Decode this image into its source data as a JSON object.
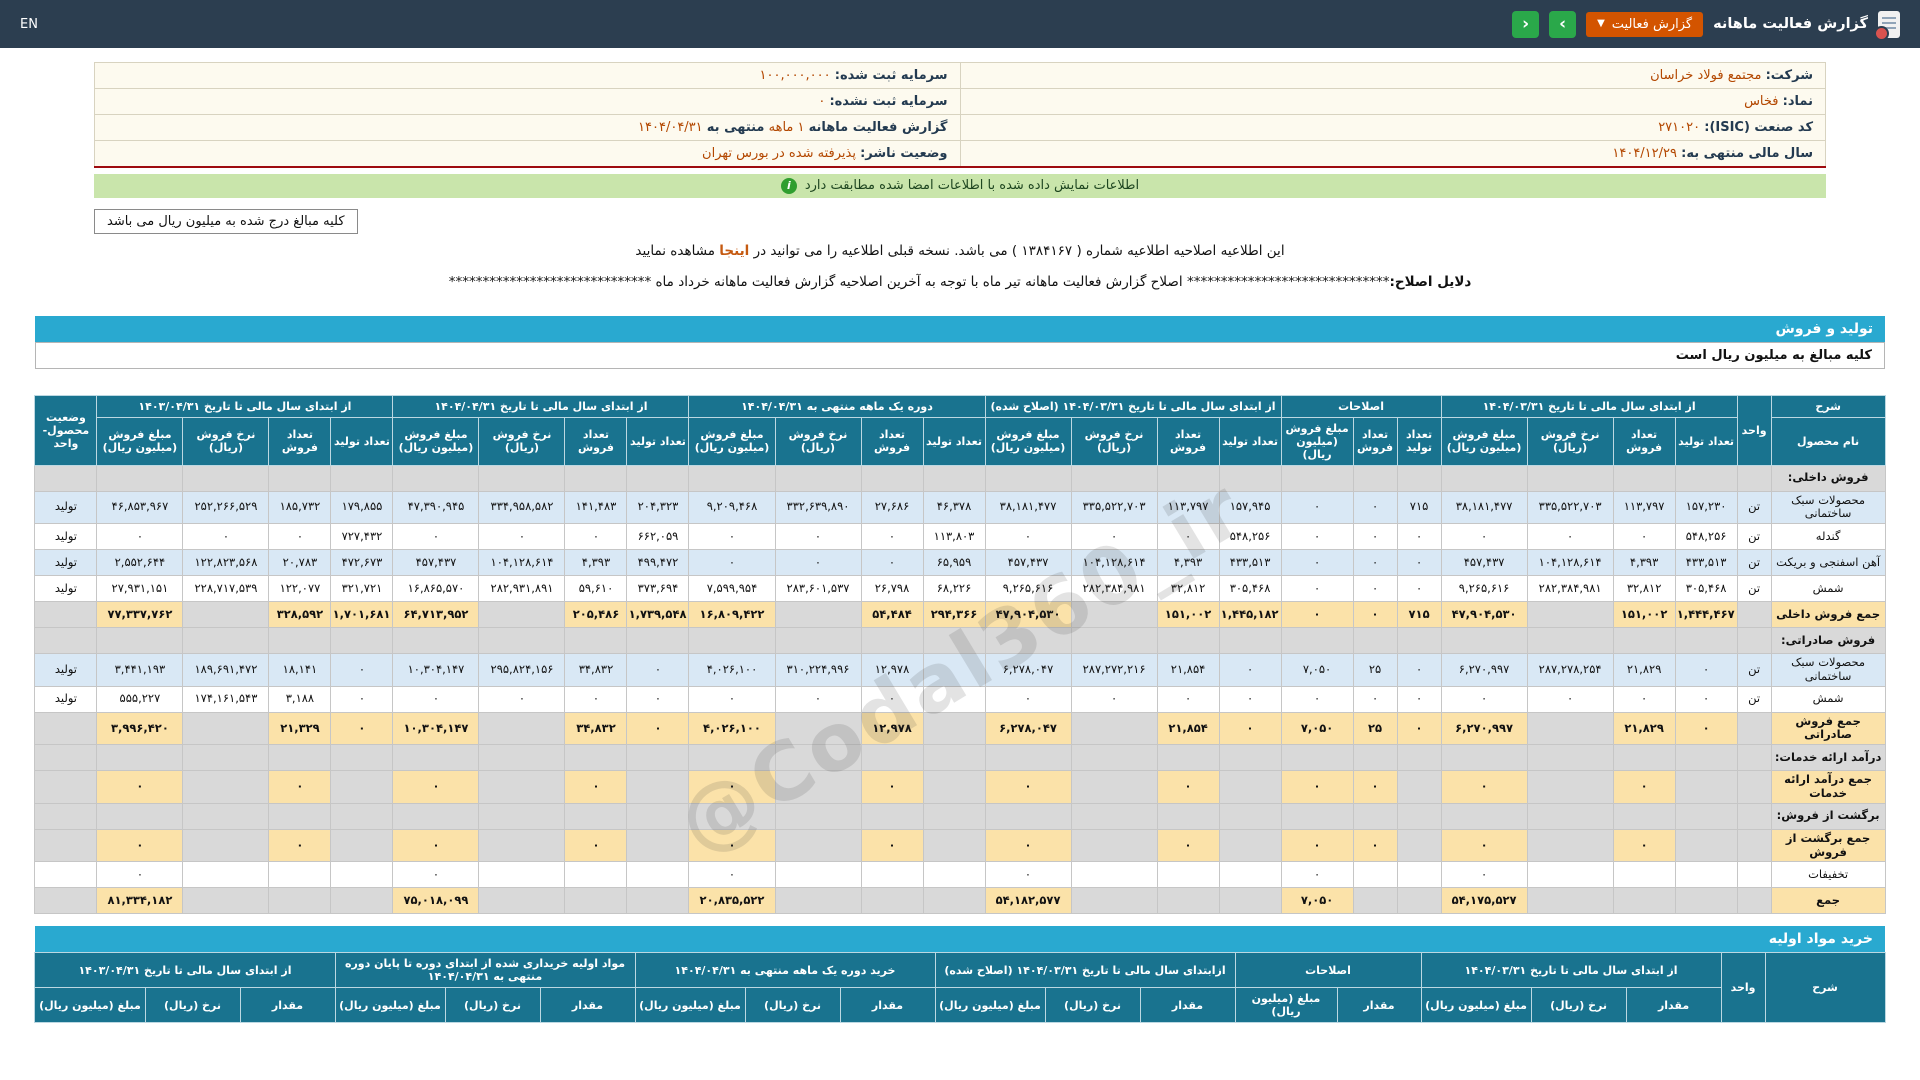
{
  "topbar": {
    "en": "EN",
    "title": "گزارش فعالیت ماهانه",
    "report_btn": "گزارش فعالیت",
    "prev_icon": "‹",
    "next_icon": "›"
  },
  "company": {
    "rows": [
      {
        "right": [
          {
            "t": "شرکت:",
            "c": "lbl"
          },
          {
            "t": "مجتمع فولاد خراسان",
            "c": "val"
          }
        ],
        "left": [
          {
            "t": "سرمایه ثبت شده:",
            "c": "lbl"
          },
          {
            "t": "۱۰۰,۰۰۰,۰۰۰",
            "c": "val"
          }
        ]
      },
      {
        "right": [
          {
            "t": "نماد:",
            "c": "lbl"
          },
          {
            "t": "فخاس",
            "c": "val"
          }
        ],
        "left": [
          {
            "t": "سرمایه ثبت نشده:",
            "c": "lbl"
          },
          {
            "t": "۰",
            "c": "val"
          }
        ]
      },
      {
        "right": [
          {
            "t": "کد صنعت (ISIC):",
            "c": "lbl"
          },
          {
            "t": "۲۷۱۰۲۰",
            "c": "val"
          }
        ],
        "left": [
          {
            "t": "گزارش فعالیت ماهانه",
            "c": "lbl"
          },
          {
            "t": "۱ ماهه",
            "c": "val"
          },
          {
            "t": "منتهی به",
            "c": "lbl"
          },
          {
            "t": "۱۴۰۴/۰۴/۳۱",
            "c": "val"
          }
        ]
      },
      {
        "right": [
          {
            "t": "سال مالی منتهی به:",
            "c": "lbl"
          },
          {
            "t": "۱۴۰۴/۱۲/۲۹",
            "c": "val"
          }
        ],
        "left": [
          {
            "t": "وضعیت ناشر:",
            "c": "lbl"
          },
          {
            "t": "پذیرفته شده در بورس تهران",
            "c": "val"
          }
        ]
      }
    ]
  },
  "match_bar": "اطلاعات نمایش داده شده با اطلاعات امضا شده مطابقت دارد",
  "amounts_box": "کلیه مبالغ درج شده به میلیون ریال می باشد",
  "notice": {
    "text_before": "این اطلاعیه اصلاحیه اطلاعیه شماره ( ۱۳۸۴۱۶۷ ) می باشد. نسخه قبلی اطلاعیه را می توانید در",
    "link": "اینجا",
    "text_after": "مشاهده نمایید"
  },
  "reason": {
    "label": "دلایل اصلاح:",
    "stars": "******************************",
    "text": "اصلاح گزارش فعالیت ماهانه تیر ماه با توجه به آخرین اصلاحیه گزارش فعالیت ماهانه خرداد ماه"
  },
  "watermark": "@Codal360_ir",
  "colors": {
    "topbar": "#2c3e50",
    "nav_green": "#2aa84a",
    "report_orange": "#d35400",
    "section_bar_blue": "#29a9d0",
    "table_header_teal": "#19738f",
    "sum_row_yellow": "#fbe2a9",
    "data_row_blue": "#d9e8f5",
    "section_row_gray": "#d9d9d9",
    "match_bar_green": "#c9e5ab",
    "company_bg": "#fdfaef",
    "red_underline": "#9e0b0f"
  },
  "sales_table": {
    "section_title": "تولید و فروش",
    "units_note": "کلیه مبالغ به میلیون ریال است",
    "desc_header": "شرح",
    "name_header": "نام محصول",
    "unit_header": "واحد",
    "status_header": "وضعیت محصول-واحد",
    "groups": [
      {
        "label": "از ابتدای سال مالی تا تاریخ ۱۴۰۴/۰۳/۳۱",
        "subs": [
          "تعداد تولید",
          "تعداد فروش",
          "نرخ فروش (ریال)",
          "مبلغ فروش (میلیون ریال)"
        ]
      },
      {
        "label": "اصلاحات",
        "subs": [
          "تعداد تولید",
          "تعداد فروش",
          "مبلغ فروش (میلیون ریال)"
        ]
      },
      {
        "label": "از ابتدای سال مالی تا تاریخ ۱۴۰۴/۰۳/۳۱ (اصلاح شده)",
        "subs": [
          "تعداد تولید",
          "تعداد فروش",
          "نرخ فروش (ریال)",
          "مبلغ فروش (میلیون ریال)"
        ]
      },
      {
        "label": "دوره یک ماهه منتهی به ۱۴۰۴/۰۴/۳۱",
        "subs": [
          "تعداد تولید",
          "تعداد فروش",
          "نرخ فروش (ریال)",
          "مبلغ فروش (میلیون ریال)"
        ]
      },
      {
        "label": "از ابتدای سال مالی تا تاریخ ۱۴۰۴/۰۴/۳۱",
        "subs": [
          "تعداد تولید",
          "تعداد فروش",
          "نرخ فروش (ریال)",
          "مبلغ فروش (میلیون ریال)"
        ]
      },
      {
        "label": "از ابتدای سال مالی تا تاریخ ۱۴۰۳/۰۴/۳۱",
        "subs": [
          "تعداد تولید",
          "تعداد فروش",
          "نرخ فروش (ریال)",
          "مبلغ فروش (میلیون ریال)"
        ]
      }
    ],
    "rows": [
      {
        "type": "section",
        "name": "فروش داخلی:"
      },
      {
        "type": "data",
        "alt": "b",
        "name": "محصولات سبک ساختمانی",
        "unit": "تن",
        "status": "تولید",
        "cells": [
          "۱۵۷,۲۳۰",
          "۱۱۳,۷۹۷",
          "۳۳۵,۵۲۲,۷۰۳",
          "۳۸,۱۸۱,۴۷۷",
          "۷۱۵",
          "۰",
          "۰",
          "۱۵۷,۹۴۵",
          "۱۱۳,۷۹۷",
          "۳۳۵,۵۲۲,۷۰۳",
          "۳۸,۱۸۱,۴۷۷",
          "۴۶,۳۷۸",
          "۲۷,۶۸۶",
          "۳۳۲,۶۳۹,۸۹۰",
          "۹,۲۰۹,۴۶۸",
          "۲۰۴,۳۲۳",
          "۱۴۱,۴۸۳",
          "۳۳۴,۹۵۸,۵۸۲",
          "۴۷,۳۹۰,۹۴۵",
          "۱۷۹,۸۵۵",
          "۱۸۵,۷۳۲",
          "۲۵۲,۲۶۶,۵۲۹",
          "۴۶,۸۵۳,۹۶۷"
        ]
      },
      {
        "type": "data",
        "alt": "w",
        "name": "گندله",
        "unit": "تن",
        "status": "تولید",
        "cells": [
          "۵۴۸,۲۵۶",
          "۰",
          "۰",
          "۰",
          "۰",
          "۰",
          "۰",
          "۵۴۸,۲۵۶",
          "۰",
          "۰",
          "۰",
          "۱۱۳,۸۰۳",
          "۰",
          "۰",
          "۰",
          "۶۶۲,۰۵۹",
          "۰",
          "۰",
          "۰",
          "۷۲۷,۴۳۲",
          "۰",
          "۰",
          "۰"
        ]
      },
      {
        "type": "data",
        "alt": "b",
        "name": "آهن اسفنجی و بریکت",
        "unit": "تن",
        "status": "تولید",
        "cells": [
          "۴۳۳,۵۱۳",
          "۴,۳۹۳",
          "۱۰۴,۱۲۸,۶۱۴",
          "۴۵۷,۴۳۷",
          "۰",
          "۰",
          "۰",
          "۴۳۳,۵۱۳",
          "۴,۳۹۳",
          "۱۰۴,۱۲۸,۶۱۴",
          "۴۵۷,۴۳۷",
          "۶۵,۹۵۹",
          "۰",
          "۰",
          "۰",
          "۴۹۹,۴۷۲",
          "۴,۳۹۳",
          "۱۰۴,۱۲۸,۶۱۴",
          "۴۵۷,۴۳۷",
          "۴۷۲,۶۷۳",
          "۲۰,۷۸۳",
          "۱۲۲,۸۲۳,۵۶۸",
          "۲,۵۵۲,۶۴۴"
        ]
      },
      {
        "type": "data",
        "alt": "w",
        "name": "شمش",
        "unit": "تن",
        "status": "تولید",
        "cells": [
          "۳۰۵,۴۶۸",
          "۳۲,۸۱۲",
          "۲۸۲,۳۸۴,۹۸۱",
          "۹,۲۶۵,۶۱۶",
          "۰",
          "۰",
          "۰",
          "۳۰۵,۴۶۸",
          "۳۲,۸۱۲",
          "۲۸۲,۳۸۴,۹۸۱",
          "۹,۲۶۵,۶۱۶",
          "۶۸,۲۲۶",
          "۲۶,۷۹۸",
          "۲۸۳,۶۰۱,۵۳۷",
          "۷,۵۹۹,۹۵۴",
          "۳۷۳,۶۹۴",
          "۵۹,۶۱۰",
          "۲۸۲,۹۳۱,۸۹۱",
          "۱۶,۸۶۵,۵۷۰",
          "۳۲۱,۷۲۱",
          "۱۲۲,۰۷۷",
          "۲۲۸,۷۱۷,۵۳۹",
          "۲۷,۹۳۱,۱۵۱"
        ]
      },
      {
        "type": "sum",
        "name": "جمع فروش داخلی",
        "cells": [
          "۱,۴۴۴,۴۶۷",
          "۱۵۱,۰۰۲",
          "",
          "۴۷,۹۰۴,۵۳۰",
          "۷۱۵",
          "۰",
          "۰",
          "۱,۴۴۵,۱۸۲",
          "۱۵۱,۰۰۲",
          "",
          "۴۷,۹۰۴,۵۳۰",
          "۲۹۴,۳۶۶",
          "۵۴,۴۸۴",
          "",
          "۱۶,۸۰۹,۴۲۲",
          "۱,۷۳۹,۵۴۸",
          "۲۰۵,۴۸۶",
          "",
          "۶۴,۷۱۳,۹۵۲",
          "۱,۷۰۱,۶۸۱",
          "۳۲۸,۵۹۲",
          "",
          "۷۷,۳۳۷,۷۶۲"
        ]
      },
      {
        "type": "section",
        "name": "فروش صادراتی:"
      },
      {
        "type": "data",
        "alt": "b",
        "name": "محصولات سبک ساختمانی",
        "unit": "تن",
        "status": "تولید",
        "cells": [
          "۰",
          "۲۱,۸۲۹",
          "۲۸۷,۲۷۸,۲۵۴",
          "۶,۲۷۰,۹۹۷",
          "۰",
          "۲۵",
          "۷,۰۵۰",
          "۰",
          "۲۱,۸۵۴",
          "۲۸۷,۲۷۲,۲۱۶",
          "۶,۲۷۸,۰۴۷",
          "",
          "۱۲,۹۷۸",
          "۳۱۰,۲۲۴,۹۹۶",
          "۴,۰۲۶,۱۰۰",
          "۰",
          "۳۴,۸۳۲",
          "۲۹۵,۸۲۴,۱۵۶",
          "۱۰,۳۰۴,۱۴۷",
          "۰",
          "۱۸,۱۴۱",
          "۱۸۹,۶۹۱,۴۷۲",
          "۳,۴۴۱,۱۹۳"
        ]
      },
      {
        "type": "data",
        "alt": "w",
        "name": "شمش",
        "unit": "تن",
        "status": "تولید",
        "cells": [
          "۰",
          "۰",
          "۰",
          "۰",
          "۰",
          "۰",
          "۰",
          "۰",
          "۰",
          "۰",
          "۰",
          "",
          "۰",
          "۰",
          "۰",
          "۰",
          "۰",
          "۰",
          "۰",
          "۰",
          "۳,۱۸۸",
          "۱۷۴,۱۶۱,۵۴۳",
          "۵۵۵,۲۲۷"
        ]
      },
      {
        "type": "sum",
        "name": "جمع فروش صادراتی",
        "cells": [
          "۰",
          "۲۱,۸۲۹",
          "",
          "۶,۲۷۰,۹۹۷",
          "۰",
          "۲۵",
          "۷,۰۵۰",
          "۰",
          "۲۱,۸۵۴",
          "",
          "۶,۲۷۸,۰۴۷",
          "",
          "۱۲,۹۷۸",
          "",
          "۴,۰۲۶,۱۰۰",
          "۰",
          "۳۴,۸۳۲",
          "",
          "۱۰,۳۰۴,۱۴۷",
          "۰",
          "۲۱,۳۲۹",
          "",
          "۳,۹۹۶,۴۲۰"
        ]
      },
      {
        "type": "section",
        "name": "درآمد ارائه خدمات:"
      },
      {
        "type": "sum",
        "name": "جمع درآمد ارائه خدمات",
        "cells": [
          "",
          "۰",
          "",
          "۰",
          "",
          "۰",
          "۰",
          "",
          "۰",
          "",
          "۰",
          "",
          "۰",
          "",
          "۰",
          "",
          "۰",
          "",
          "۰",
          "",
          "۰",
          "",
          "۰"
        ]
      },
      {
        "type": "section",
        "name": "برگشت از فروش:"
      },
      {
        "type": "sum",
        "name": "جمع برگشت از فروش",
        "cells": [
          "",
          "۰",
          "",
          "۰",
          "",
          "۰",
          "۰",
          "",
          "۰",
          "",
          "۰",
          "",
          "۰",
          "",
          "۰",
          "",
          "۰",
          "",
          "۰",
          "",
          "۰",
          "",
          "۰"
        ]
      },
      {
        "type": "data",
        "alt": "w",
        "name": "تخفیفات",
        "cells": [
          "",
          "",
          "",
          "۰",
          "",
          "",
          "۰",
          "",
          "",
          "",
          "۰",
          "",
          "",
          "",
          "۰",
          "",
          "",
          "",
          "۰",
          "",
          "",
          "",
          "۰"
        ]
      },
      {
        "type": "sum",
        "name": "جمع",
        "cells": [
          "",
          "",
          "",
          "۵۴,۱۷۵,۵۲۷",
          "",
          "",
          "۷,۰۵۰",
          "",
          "",
          "",
          "۵۴,۱۸۲,۵۷۷",
          "",
          "",
          "",
          "۲۰,۸۳۵,۵۲۲",
          "",
          "",
          "",
          "۷۵,۰۱۸,۰۹۹",
          "",
          "",
          "",
          "۸۱,۳۳۴,۱۸۲"
        ]
      }
    ]
  },
  "purchase_table": {
    "section_title": "خرید مواد اولیه",
    "desc_header": "شرح",
    "unit_header": "واحد",
    "groups": [
      {
        "label": "از ابتدای سال مالی تا تاریخ ۱۴۰۴/۰۳/۳۱",
        "subs": [
          "مقدار",
          "نرخ (ریال)",
          "مبلغ (میلیون ریال)"
        ]
      },
      {
        "label": "اصلاحات",
        "subs": [
          "مقدار",
          "مبلغ (میلیون ریال)"
        ]
      },
      {
        "label": "ازابتدای سال مالی تا تاریخ ۱۴۰۴/۰۳/۳۱ (اصلاح شده)",
        "subs": [
          "مقدار",
          "نرخ (ریال)",
          "مبلغ (میلیون ریال)"
        ]
      },
      {
        "label": "خرید دوره یک ماهه منتهی به ۱۴۰۴/۰۴/۳۱",
        "subs": [
          "مقدار",
          "نرخ (ریال)",
          "مبلغ (میلیون ریال)"
        ]
      },
      {
        "label": "مواد اولیه خریداری شده از ابتدای دوره تا پایان دوره منتهی به ۱۴۰۴/۰۴/۳۱",
        "subs": [
          "مقدار",
          "نرخ (ریال)",
          "مبلغ (میلیون ریال)"
        ]
      },
      {
        "label": "از ابتدای سال مالی تا تاریخ ۱۴۰۳/۰۴/۳۱",
        "subs": [
          "مقدار",
          "نرخ (ریال)",
          "مبلغ (میلیون ریال)"
        ]
      }
    ]
  }
}
